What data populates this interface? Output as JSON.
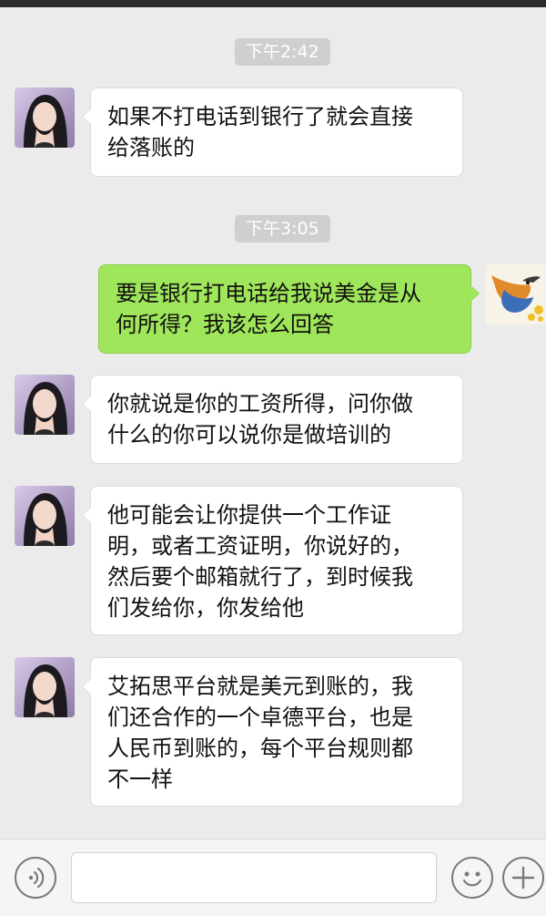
{
  "chat": {
    "timestamps": [
      "下午2:42",
      "下午3:05"
    ],
    "messages": [
      {
        "side": "left",
        "text": "如果不打电话到银行了就会直接\n给落账的"
      },
      {
        "side": "right",
        "text": "要是银行打电话给我说美金是从\n何所得？我该怎么回答"
      },
      {
        "side": "left",
        "text": "你就说是你的工资所得，问你做\n什么的你可以说你是做培训的"
      },
      {
        "side": "left",
        "text": "他可能会让你提供一个工作证\n明，或者工资证明，你说好的，\n然后要个邮箱就行了，到时候我\n们发给你，你发给他"
      },
      {
        "side": "left",
        "text": "艾拓思平台就是美元到账的，我\n们还合作的一个卓德平台，也是\n人民币到账的，每个平台规则都\n不一样"
      }
    ]
  },
  "input": {
    "placeholder": "",
    "voice_icon": "voice-icon",
    "emoji_icon": "emoji-icon",
    "plus_icon": "plus-icon"
  },
  "colors": {
    "background": "#ebebeb",
    "sent_bubble": "#9fe65a",
    "received_bubble": "#ffffff",
    "timestamp_bg": "#cfcfcf"
  }
}
